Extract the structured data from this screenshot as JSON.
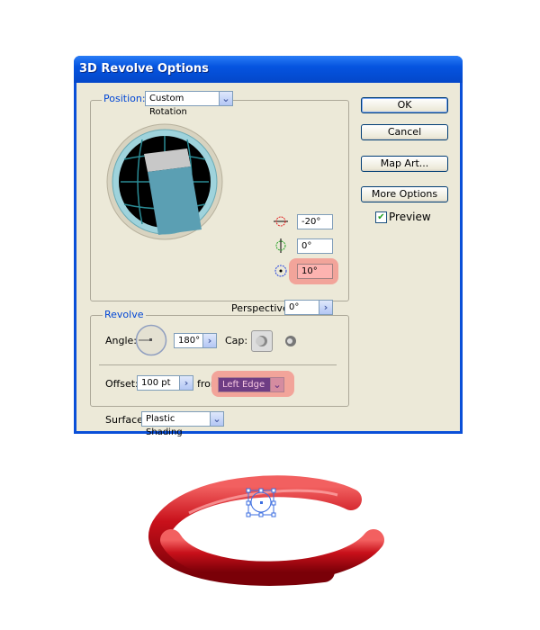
{
  "dialog": {
    "title": "3D Revolve Options"
  },
  "position": {
    "label": "Position:",
    "value": "Custom Rotation",
    "rotation_x": "-20°",
    "rotation_y": "0°",
    "rotation_z": "10°",
    "perspective_label": "Perspective:",
    "perspective": "0°"
  },
  "buttons": {
    "ok": "OK",
    "cancel": "Cancel",
    "map_art": "Map Art...",
    "more_options": "More Options"
  },
  "preview": {
    "label": "Preview",
    "checked": true
  },
  "revolve": {
    "legend": "Revolve",
    "angle_label": "Angle:",
    "angle": "180°",
    "cap_label": "Cap:",
    "offset_label": "Offset:",
    "offset": "100 pt",
    "from_label": "from",
    "from_value": "Left Edge"
  },
  "surface": {
    "label": "Surface:",
    "value": "Plastic Shading"
  },
  "colors": {
    "title_bar": "#0554e0",
    "dialog_bg": "#ece9d8",
    "highlight": "#f2a49a",
    "ring": "#c8101a"
  }
}
